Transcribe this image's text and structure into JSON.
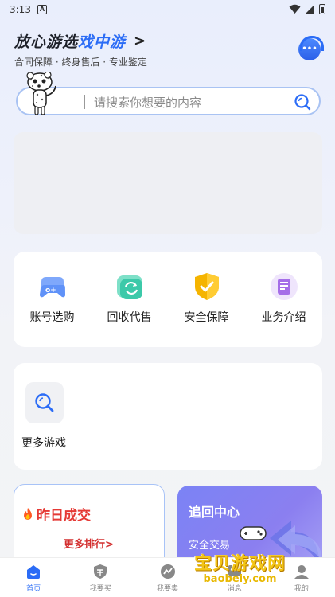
{
  "status_bar": {
    "time": "3:13",
    "notification_badge": "A"
  },
  "header": {
    "slogan_prefix": "放心游选",
    "slogan_brand": "戏中游",
    "slogan_arrow": ">",
    "sub_slogan": "合同保障 · 终身售后 · 专业鉴定",
    "support_icon": "customer-service-icon",
    "support_dots": "•••"
  },
  "search": {
    "placeholder": "请搜索你想要的内容",
    "icon": "search-icon"
  },
  "services": [
    {
      "label": "账号选购",
      "icon": "gamepad-icon",
      "color": "#5b8ef7"
    },
    {
      "label": "回收代售",
      "icon": "recycle-icon",
      "color": "#3cc9a9"
    },
    {
      "label": "安全保障",
      "icon": "shield-check-icon",
      "color": "#f5b400"
    },
    {
      "label": "业务介绍",
      "icon": "document-icon",
      "color": "#a56ee8"
    }
  ],
  "games": {
    "more_label": "更多游戏",
    "icon": "search-icon"
  },
  "deal_card": {
    "title": "昨日成交",
    "more_link": "更多排行>",
    "icon": "fire-icon"
  },
  "recover_card": {
    "title": "追回中心",
    "description": "安全交易"
  },
  "watermark": {
    "cn": "宝贝游戏网",
    "en": "baobeiy.com"
  },
  "bottom_nav": [
    {
      "label": "首页",
      "icon": "home-icon",
      "active": true
    },
    {
      "label": "我要买",
      "icon": "buy-shield-icon",
      "active": false
    },
    {
      "label": "我要卖",
      "icon": "sell-icon",
      "active": false
    },
    {
      "label": "消息",
      "icon": "message-icon",
      "active": false
    },
    {
      "label": "我的",
      "icon": "profile-icon",
      "active": false
    }
  ],
  "colors": {
    "accent": "#2b6cf6",
    "deal_red": "#e53935",
    "recover_purple": "#8b7ff0"
  }
}
